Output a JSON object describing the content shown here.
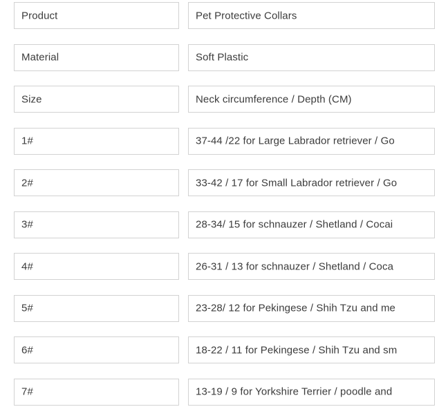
{
  "table": {
    "rows": [
      {
        "label": "Product",
        "value": "Pet Protective Collars"
      },
      {
        "label": "Material",
        "value": "Soft Plastic"
      },
      {
        "label": "Size",
        "value": "Neck circumference / Depth (CM)"
      },
      {
        "label": "1#",
        "value": "37-44  /22 for Large Labrador retriever / Go"
      },
      {
        "label": "2#",
        "value": "33-42 / 17 for Small Labrador retriever / Go"
      },
      {
        "label": "3#",
        "value": "28-34/ 15 for schnauzer / Shetland / Cocai"
      },
      {
        "label": "4#",
        "value": "26-31 / 13 for schnauzer / Shetland / Coca"
      },
      {
        "label": "5#",
        "value": "23-28/ 12 for Pekingese / Shih Tzu and me"
      },
      {
        "label": "6#",
        "value": "18-22 / 11 for Pekingese / Shih Tzu and sm"
      },
      {
        "label": "7#",
        "value": "13-19 / 9 for  Yorkshire Terrier / poodle and"
      }
    ]
  },
  "colors": {
    "border": "#d2d2d2",
    "text": "#3c3c3c",
    "background": "#ffffff"
  }
}
